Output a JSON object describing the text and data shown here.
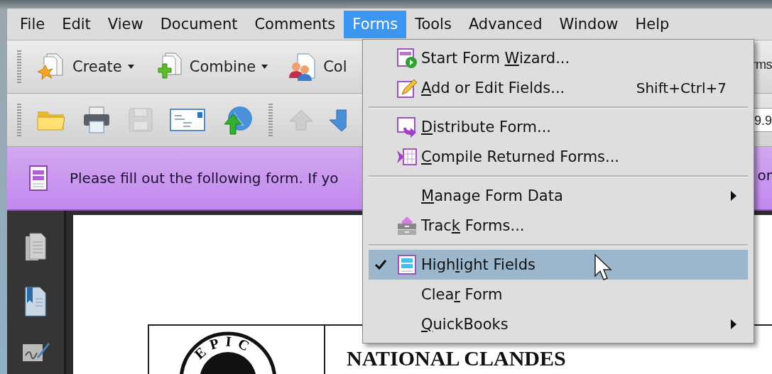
{
  "menubar": [
    {
      "label": "File",
      "selected": false
    },
    {
      "label": "Edit",
      "selected": false
    },
    {
      "label": "View",
      "selected": false
    },
    {
      "label": "Document",
      "selected": false
    },
    {
      "label": "Comments",
      "selected": false
    },
    {
      "label": "Forms",
      "selected": true
    },
    {
      "label": "Tools",
      "selected": false
    },
    {
      "label": "Advanced",
      "selected": false
    },
    {
      "label": "Window",
      "selected": false
    },
    {
      "label": "Help",
      "selected": false
    }
  ],
  "toolbar_1": {
    "buttons": [
      {
        "kind": "create",
        "label": "Create",
        "dropdown": true
      },
      {
        "kind": "combine",
        "label": "Combine",
        "dropdown": true
      },
      {
        "kind": "collaborate",
        "label": "Col",
        "dropdown": false
      }
    ],
    "label_right": "rms"
  },
  "toolbar_2": {
    "buttons": [
      {
        "kind": "open",
        "disabled": false
      },
      {
        "kind": "print",
        "disabled": false
      },
      {
        "kind": "save",
        "disabled": true
      },
      {
        "kind": "email",
        "disabled": false
      },
      {
        "kind": "upload",
        "disabled": false
      },
      {
        "kind": "separator"
      },
      {
        "kind": "up",
        "disabled": true
      },
      {
        "kind": "down",
        "disabled": false
      }
    ],
    "zoom_value": "9.9"
  },
  "form_bar": {
    "message": "Please fill out the following form. If yo",
    "message_right": "or"
  },
  "sidebar": [
    {
      "kind": "pages"
    },
    {
      "kind": "bookmarks"
    },
    {
      "kind": "signatures"
    }
  ],
  "document": {
    "seal_text": "EPIC",
    "heading": "NATIONAL CLANDES"
  },
  "forms_menu": {
    "items": [
      {
        "kind": "wizard",
        "text_before": "Start Form ",
        "mnemonic": "W",
        "text_after": "izard...",
        "checked": false,
        "selected": false,
        "submenu": false
      },
      {
        "kind": "edit",
        "mnemonic": "A",
        "text_after": "dd or Edit Fields...",
        "shortcut": "Shift+Ctrl+7",
        "checked": false,
        "selected": false,
        "submenu": false
      },
      {
        "kind": "separator"
      },
      {
        "kind": "distribute",
        "mnemonic": "D",
        "text_after": "istribute Form...",
        "checked": false,
        "selected": false,
        "submenu": false
      },
      {
        "kind": "compile",
        "mnemonic": "C",
        "text_after": "ompile Returned Forms...",
        "checked": false,
        "selected": false,
        "submenu": false
      },
      {
        "kind": "separator"
      },
      {
        "kind": "plain",
        "mnemonic": "M",
        "text_after": "anage Form Data",
        "checked": false,
        "selected": false,
        "submenu": true
      },
      {
        "kind": "track",
        "text_before": "Trac",
        "mnemonic": "k",
        "text_after": " Forms...",
        "checked": false,
        "selected": false,
        "submenu": false
      },
      {
        "kind": "separator"
      },
      {
        "kind": "highlight",
        "text_before": "High",
        "mnemonic": "l",
        "text_after": "ight Fields",
        "checked": true,
        "selected": true,
        "submenu": false
      },
      {
        "kind": "plain",
        "text_before": "Clea",
        "mnemonic": "r",
        "text_after": " Form",
        "checked": false,
        "selected": false,
        "submenu": false
      },
      {
        "kind": "plain",
        "mnemonic": "Q",
        "text_after": "uickBooks",
        "checked": false,
        "selected": false,
        "submenu": true
      }
    ]
  }
}
